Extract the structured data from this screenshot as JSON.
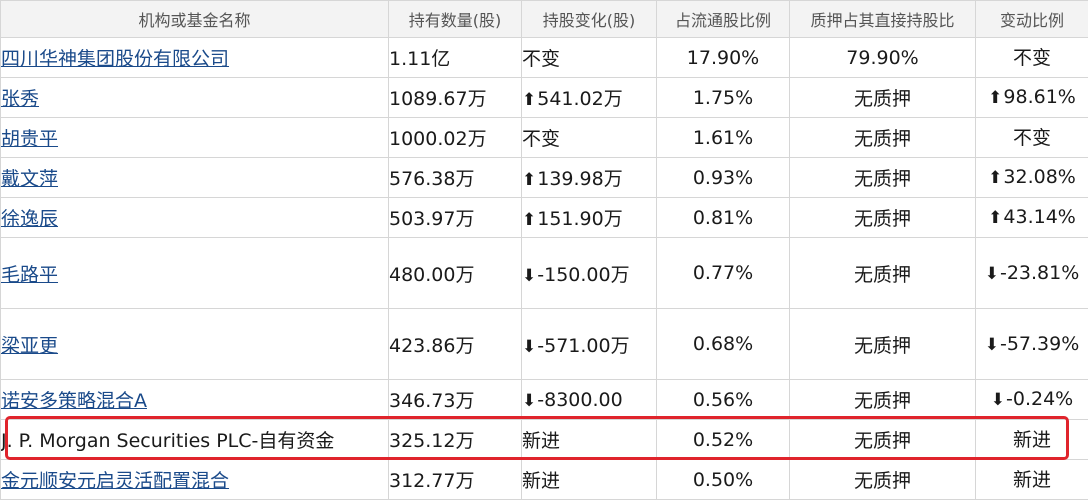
{
  "table": {
    "headers": [
      "机构或基金名称",
      "持有数量(股)",
      "持股变化(股)",
      "占流通股比例",
      "质押占其直接持股比",
      "变动比例"
    ],
    "rows": [
      {
        "name": "四川华神集团股份有限公司",
        "link": true,
        "qty": "1.11亿",
        "change": "不变",
        "change_dir": "neutral",
        "pct": "17.90%",
        "pledge": "79.90%",
        "ratio": "不变",
        "ratio_dir": "neutral"
      },
      {
        "name": "张秀",
        "link": true,
        "qty": "1089.67万",
        "change": "541.02万",
        "change_dir": "up",
        "pct": "1.75%",
        "pledge": "无质押",
        "ratio": "98.61%",
        "ratio_dir": "up"
      },
      {
        "name": "胡贵平",
        "link": true,
        "qty": "1000.02万",
        "change": "不变",
        "change_dir": "neutral",
        "pct": "1.61%",
        "pledge": "无质押",
        "ratio": "不变",
        "ratio_dir": "neutral"
      },
      {
        "name": "戴文萍",
        "link": true,
        "qty": "576.38万",
        "change": "139.98万",
        "change_dir": "up",
        "pct": "0.93%",
        "pledge": "无质押",
        "ratio": "32.08%",
        "ratio_dir": "up"
      },
      {
        "name": "徐逸辰",
        "link": true,
        "qty": "503.97万",
        "change": "151.90万",
        "change_dir": "up",
        "pct": "0.81%",
        "pledge": "无质押",
        "ratio": "43.14%",
        "ratio_dir": "up"
      },
      {
        "name": "毛路平",
        "link": true,
        "qty": "480.00万",
        "change": "-150.00万",
        "change_dir": "down",
        "pct": "0.77%",
        "pledge": "无质押",
        "ratio": "-23.81%",
        "ratio_dir": "down"
      },
      {
        "name": "梁亚更",
        "link": true,
        "qty": "423.86万",
        "change": "-571.00万",
        "change_dir": "down",
        "pct": "0.68%",
        "pledge": "无质押",
        "ratio": "-57.39%",
        "ratio_dir": "down"
      },
      {
        "name": "诺安多策略混合A",
        "link": true,
        "qty": "346.73万",
        "change": "-8300.00",
        "change_dir": "down",
        "pct": "0.56%",
        "pledge": "无质押",
        "ratio": "-0.24%",
        "ratio_dir": "down"
      },
      {
        "name": "J. P. Morgan Securities PLC-自有资金",
        "link": false,
        "qty": "325.12万",
        "change": "新进",
        "change_dir": "new",
        "pct": "0.52%",
        "pledge": "无质押",
        "ratio": "新进",
        "ratio_dir": "new"
      },
      {
        "name": "金元顺安元启灵活配置混合",
        "link": true,
        "qty": "312.77万",
        "change": "新进",
        "change_dir": "new",
        "pct": "0.50%",
        "pledge": "无质押",
        "ratio": "新进",
        "ratio_dir": "new"
      }
    ]
  },
  "icons": {
    "up": "arrow-up-icon",
    "down": "arrow-down-icon"
  },
  "colors": {
    "up": "#b01818",
    "down": "#2e8b2e",
    "link": "#1a4a8a",
    "highlight": "#e0242c"
  }
}
